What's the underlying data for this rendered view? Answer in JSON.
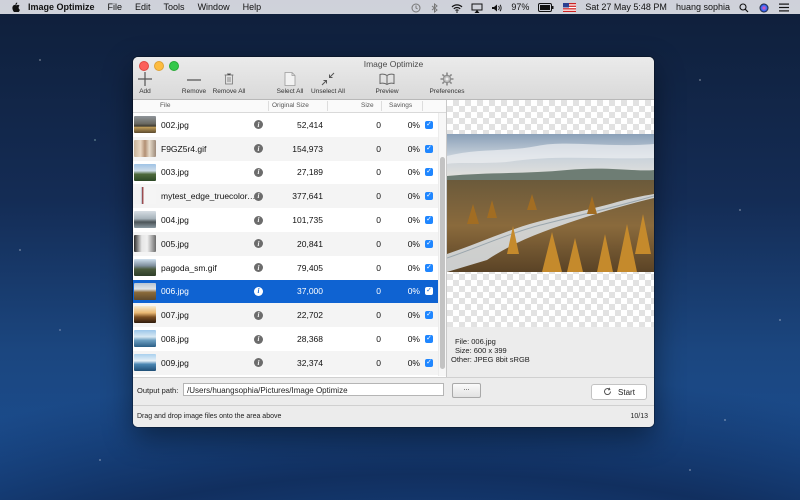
{
  "menubar": {
    "app_name": "Image Optimize",
    "menus": [
      "File",
      "Edit",
      "Tools",
      "Window",
      "Help"
    ],
    "battery": "97%",
    "datetime": "Sat 27 May  5:48 PM",
    "user": "huang sophia"
  },
  "window": {
    "title": "Image Optimize",
    "toolbar": {
      "add": "Add",
      "remove": "Remove",
      "remove_all": "Remove All",
      "select_all": "Select All",
      "unselect_all": "Unselect All",
      "preview": "Preview",
      "preferences": "Preferences"
    },
    "columns": {
      "file": "File",
      "original_size": "Original Size",
      "size": "Size",
      "savings": "Savings"
    },
    "rows": [
      {
        "file": "002.jpg",
        "original": "52,414",
        "size": "0",
        "savings": "0%",
        "checked": true
      },
      {
        "file": "F9GZ5r4.gif",
        "original": "154,973",
        "size": "0",
        "savings": "0%",
        "checked": true
      },
      {
        "file": "003.jpg",
        "original": "27,189",
        "size": "0",
        "savings": "0%",
        "checked": true
      },
      {
        "file": "mytest_edge_truecolor.png",
        "original": "377,641",
        "size": "0",
        "savings": "0%",
        "checked": true
      },
      {
        "file": "004.jpg",
        "original": "101,735",
        "size": "0",
        "savings": "0%",
        "checked": true
      },
      {
        "file": "005.jpg",
        "original": "20,841",
        "size": "0",
        "savings": "0%",
        "checked": true
      },
      {
        "file": "pagoda_sm.gif",
        "original": "79,405",
        "size": "0",
        "savings": "0%",
        "checked": true
      },
      {
        "file": "006.jpg",
        "original": "37,000",
        "size": "0",
        "savings": "0%",
        "checked": true
      },
      {
        "file": "007.jpg",
        "original": "22,702",
        "size": "0",
        "savings": "0%",
        "checked": true
      },
      {
        "file": "008.jpg",
        "original": "28,368",
        "size": "0",
        "savings": "0%",
        "checked": true
      },
      {
        "file": "009.jpg",
        "original": "32,374",
        "size": "0",
        "savings": "0%",
        "checked": true
      }
    ],
    "selected_row": "006.jpg",
    "details": {
      "file": "File: 006.jpg",
      "size": "Size: 600 x 399",
      "other": "Other: JPEG 8bit sRGB"
    },
    "output_label": "Output path:",
    "output_path": "/Users/huangsophia/Pictures/Image Optimize",
    "browse_label": "...",
    "start_label": "Start",
    "status_hint": "Drag and drop image files onto the area above",
    "counter": "10/13"
  },
  "colors": {
    "selection": "#0f63d2",
    "checkbox": "#1f86ff"
  }
}
